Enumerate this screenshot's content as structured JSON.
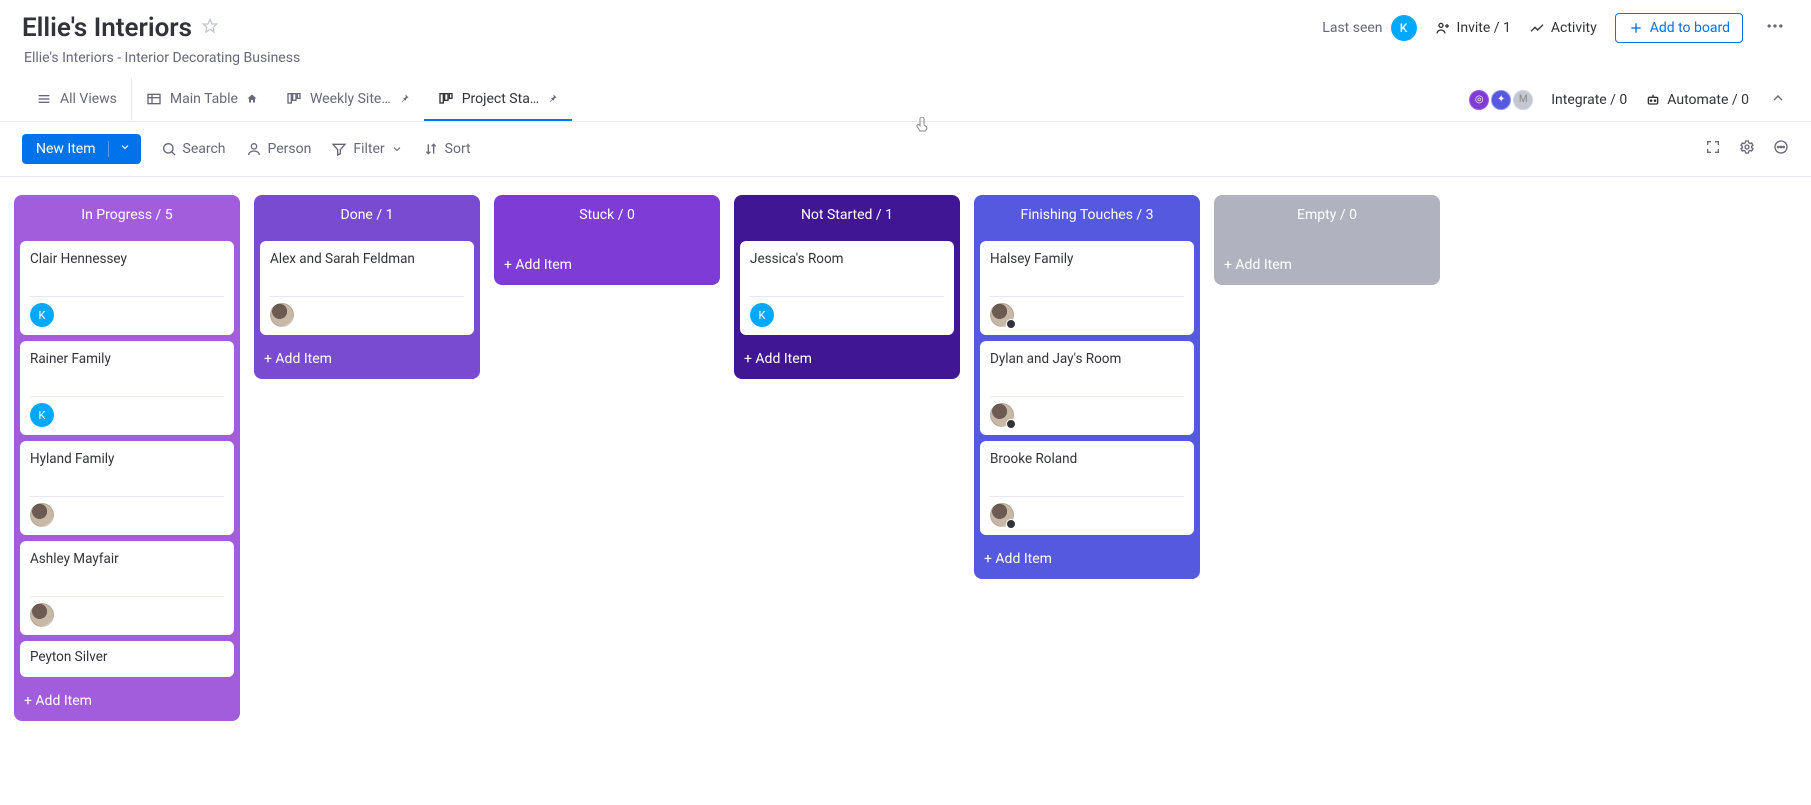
{
  "header": {
    "title": "Ellie's Interiors",
    "subtitle": "Ellie's Interiors - Interior Decorating Business",
    "last_seen_label": "Last seen",
    "invite_label": "Invite / 1",
    "activity_label": "Activity",
    "add_to_board_label": "Add to board",
    "avatar_initial": "K"
  },
  "tabs": {
    "all_views": "All Views",
    "main_table": "Main Table",
    "weekly_site": "Weekly Site…",
    "project_sta": "Project Sta…",
    "integrate_label": "Integrate / 0",
    "automate_label": "Automate / 0"
  },
  "toolbar": {
    "new_item": "New Item",
    "search": "Search",
    "person": "Person",
    "filter": "Filter",
    "sort": "Sort"
  },
  "add_item_label": "+ Add Item",
  "columns": [
    {
      "title": "In Progress / 5",
      "color": "c-inprog",
      "cards": [
        {
          "title": "Clair Hennessey",
          "avatar": "k"
        },
        {
          "title": "Rainer Family",
          "avatar": "k"
        },
        {
          "title": "Hyland Family",
          "avatar": "img"
        },
        {
          "title": "Ashley Mayfair",
          "avatar": "img"
        },
        {
          "title": "Peyton Silver",
          "short": true
        }
      ]
    },
    {
      "title": "Done / 1",
      "color": "c-done",
      "cards": [
        {
          "title": "Alex and Sarah Feldman",
          "avatar": "img"
        }
      ]
    },
    {
      "title": "Stuck / 0",
      "color": "c-stuck",
      "cards": []
    },
    {
      "title": "Not Started / 1",
      "color": "c-notstart",
      "cards": [
        {
          "title": "Jessica's Room",
          "avatar": "k"
        }
      ]
    },
    {
      "title": "Finishing Touches / 3",
      "color": "c-finish",
      "cards": [
        {
          "title": "Halsey Family",
          "avatar": "img",
          "badge": true
        },
        {
          "title": "Dylan and Jay's Room",
          "avatar": "img",
          "badge": true
        },
        {
          "title": "Brooke Roland",
          "avatar": "img",
          "badge": true
        }
      ]
    },
    {
      "title": "Empty / 0",
      "color": "c-empty",
      "cards": []
    }
  ]
}
